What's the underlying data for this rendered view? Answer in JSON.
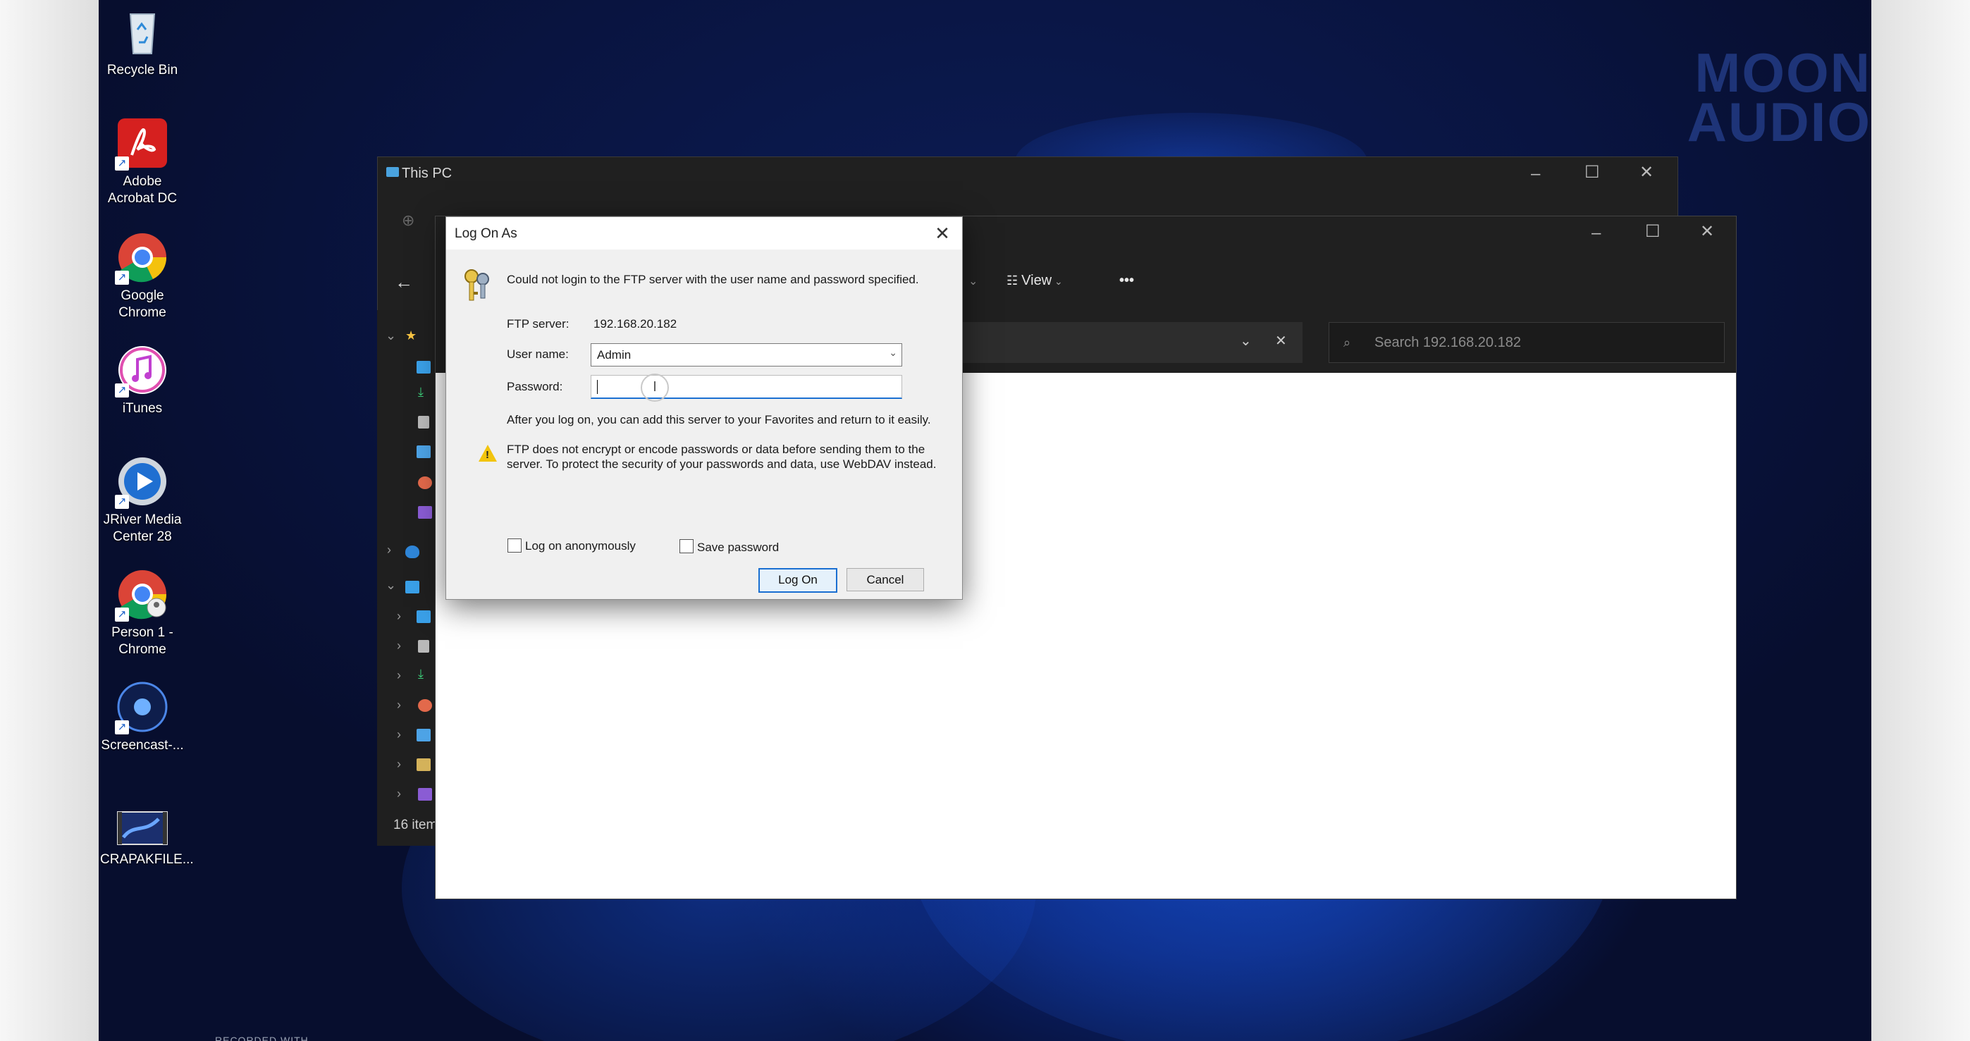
{
  "desktop": {
    "watermark_line1": "MOON",
    "watermark_line2": "AUDIO",
    "icons": [
      {
        "label_line1": "Recycle Bin",
        "label_line2": ""
      },
      {
        "label_line1": "Adobe",
        "label_line2": "Acrobat DC"
      },
      {
        "label_line1": "Google",
        "label_line2": "Chrome"
      },
      {
        "label_line1": "iTunes",
        "label_line2": ""
      },
      {
        "label_line1": "JRiver Media",
        "label_line2": "Center 28"
      },
      {
        "label_line1": "Person 1 -",
        "label_line2": "Chrome"
      },
      {
        "label_line1": "Screencast-...",
        "label_line2": ""
      },
      {
        "label_line1": "CRAPAKFILE...",
        "label_line2": ""
      }
    ]
  },
  "explorer_back": {
    "title": "This PC"
  },
  "explorer_front": {
    "view_label": "View",
    "more_label": "•••",
    "search_placeholder": "Search 192.168.20.182",
    "status": "16 item"
  },
  "dialog": {
    "title": "Log On As",
    "message": "Could not login to the FTP server with the user name and password specified.",
    "ftp_server_label": "FTP server:",
    "ftp_server_value": "192.168.20.182",
    "username_label": "User name:",
    "username_value": "Admin",
    "password_label": "Password:",
    "password_value": "",
    "favorites_note": "After you log on, you can add this server to your Favorites and return to it easily.",
    "warning_line1": "FTP does not encrypt or encode passwords or data before sending them to the",
    "warning_line2": "server.  To protect the security of your passwords and data, use WebDAV instead.",
    "anonymous_label": "Log on anonymously",
    "anonymous_checked": false,
    "save_password_label": "Save password",
    "save_password_checked": false,
    "logon_button": "Log On",
    "cancel_button": "Cancel"
  }
}
